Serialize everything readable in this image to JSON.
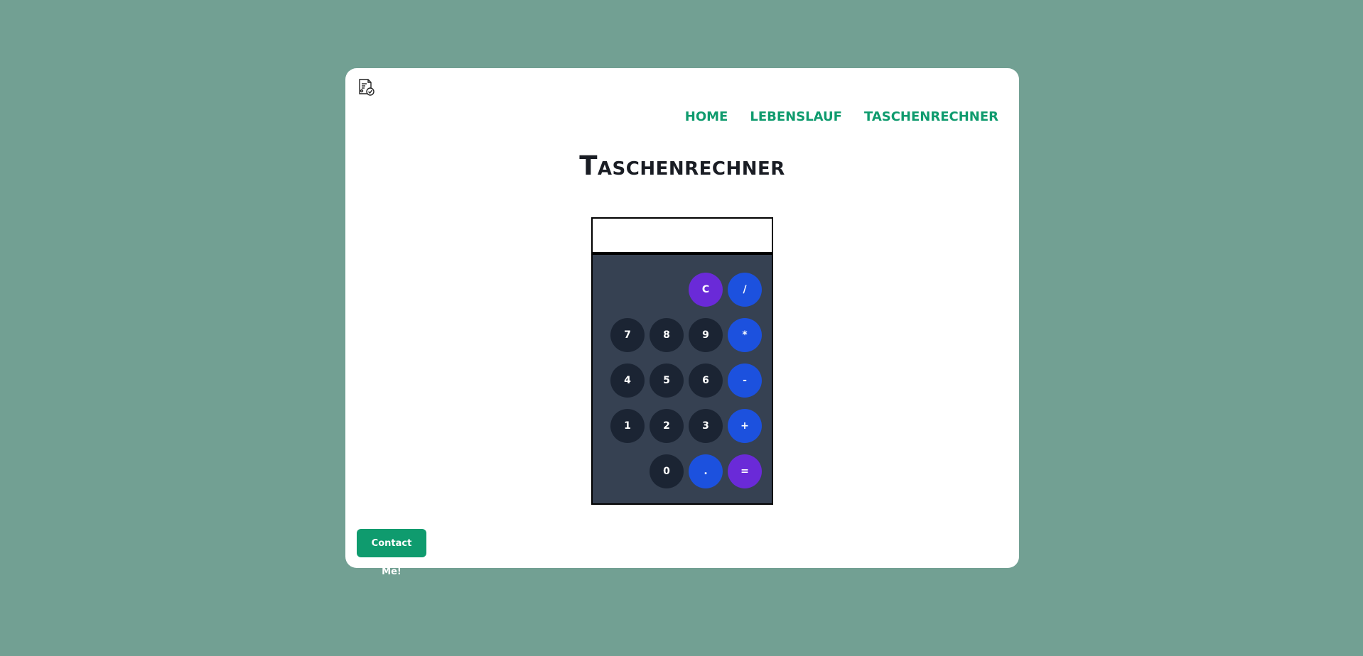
{
  "nav": {
    "items": [
      "HOME",
      "LEBENSLAUF",
      "TASCHENRECHNER"
    ]
  },
  "page": {
    "title": "Taschenrechner"
  },
  "calculator": {
    "display_value": "",
    "keys": {
      "clear": "C",
      "divide": "/",
      "seven": "7",
      "eight": "8",
      "nine": "9",
      "multiply": "*",
      "four": "4",
      "five": "5",
      "six": "6",
      "minus": "-",
      "one": "1",
      "two": "2",
      "three": "3",
      "plus": "+",
      "zero": "0",
      "decimal": ".",
      "equals": "="
    }
  },
  "footer": {
    "contact_label": "Contact Me!"
  },
  "colors": {
    "background": "#72a093",
    "accent": "#0f9b6e",
    "number_key": "#1b2433",
    "operator_key": "#1c51de",
    "special_key": "#6a2ad8",
    "keypad_bg": "#364152"
  },
  "icons": {
    "logo": "document-check-icon"
  }
}
